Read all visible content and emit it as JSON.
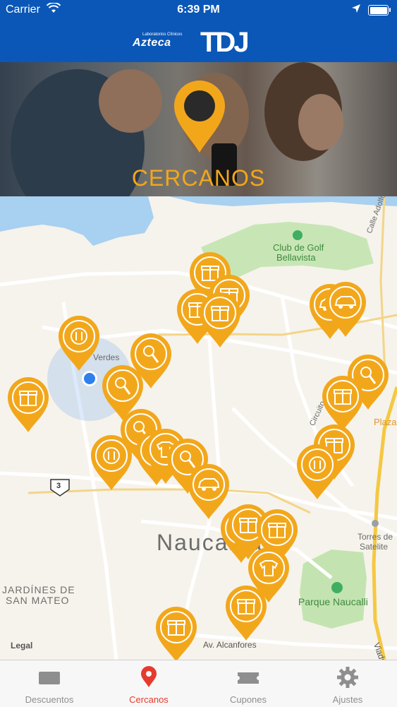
{
  "status_bar": {
    "carrier": "Carrier",
    "time": "6:39 PM",
    "wifi_icon": "wifi-icon",
    "location_icon": "location-arrow-icon",
    "battery_icon": "battery-icon"
  },
  "header": {
    "brand_primary_small": "Laboratorios Clínicos",
    "brand_primary": "Azteca",
    "brand_secondary": "TDJ",
    "color": "#0b57b7"
  },
  "banner": {
    "title": "CERCANOS",
    "icon": "location-pin-icon",
    "accent": "#f2a71b"
  },
  "map": {
    "labels": {
      "club_golf_1": "Club de Golf",
      "club_golf_2": "Bellavista",
      "calle_adolfo": "Calle Adolfo L.",
      "verdes": "Verdes",
      "circuito": "Circuito",
      "plaza": "Plaza",
      "route_number": "3",
      "naucalpan": "Naucalpan",
      "torres_1": "Torres de",
      "torres_2": "Satelite",
      "jardines_1": "JARDÍNES DE",
      "jardines_2": "SAN MATEO",
      "parque": "Parque Naucalli",
      "av_alcanfores": "Av. Alcanfores",
      "viaducto": "Viadu",
      "legal": "Legal"
    },
    "pin_color": "#f2a71b",
    "user_location_color": "#2f80ed"
  },
  "tabs": [
    {
      "label": "Descuentos",
      "icon": "ticket-icon",
      "active": false
    },
    {
      "label": "Cercanos",
      "icon": "location-pin-icon",
      "active": true
    },
    {
      "label": "Cupones",
      "icon": "coupon-icon",
      "active": false
    },
    {
      "label": "Ajustes",
      "icon": "gear-icon",
      "active": false
    }
  ]
}
